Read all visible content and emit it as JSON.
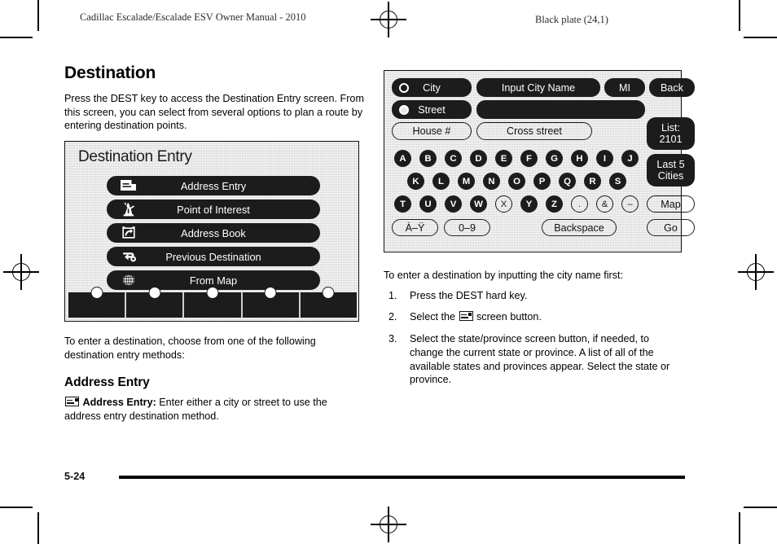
{
  "header": {
    "left_running_head": "Cadillac Escalade/Escalade ESV Owner Manual - 2010",
    "right_running_head": "Black plate (24,1)"
  },
  "footer": {
    "page_number": "5-24"
  },
  "left_column": {
    "heading": "Destination",
    "intro": "Press the DEST key to access the Destination Entry screen. From this screen, you can select from several options to plan a route by entering destination points.",
    "after_figure": "To enter a destination, choose from one of the following destination entry methods:",
    "subheading": "Address Entry",
    "address_entry_bold": "Address Entry:",
    "address_entry_text": " Enter either a city or street to use the address entry destination method."
  },
  "figure_destination_entry": {
    "title": "Destination Entry",
    "menu_items": [
      {
        "label": "Address Entry",
        "icon": "address-card-icon"
      },
      {
        "label": "Point of Interest",
        "icon": "statue-of-liberty-icon"
      },
      {
        "label": "Address Book",
        "icon": "open-book-icon"
      },
      {
        "label": "Previous Destination",
        "icon": "return-arrow-icon"
      },
      {
        "label": "From Map",
        "icon": "globe-icon"
      }
    ],
    "bottom_soft_keys": [
      "",
      "",
      "",
      "",
      ""
    ]
  },
  "figure_city_input": {
    "city_label": "City",
    "city_field_value": "Input City Name",
    "state_button": "MI",
    "back_button": "Back",
    "street_label": "Street",
    "street_field_value": "",
    "house_number_button": "House #",
    "cross_street_button": "Cross street",
    "list_button_line1": "List:",
    "list_button_line2": "2101",
    "last5_line1": "Last 5",
    "last5_line2": "Cities",
    "keyboard_row1": [
      "A",
      "B",
      "C",
      "D",
      "E",
      "F",
      "G",
      "H",
      "I",
      "J"
    ],
    "keyboard_row2": [
      "K",
      "L",
      "M",
      "N",
      "O",
      "P",
      "Q",
      "R",
      "S"
    ],
    "keyboard_row3": [
      "T",
      "U",
      "V",
      "W",
      "X",
      "Y",
      "Z"
    ],
    "symbol_keys": [
      ".",
      "&",
      "–"
    ],
    "disabled_letter": "X",
    "accent_button": "À–Ÿ",
    "numeric_button": "0–9",
    "backspace_button": "Backspace",
    "map_button": "Map",
    "go_button": "Go"
  },
  "right_column": {
    "intro": "To enter a destination by inputting the city name first:",
    "steps": [
      {
        "num": "1.",
        "text_before": "Press the DEST hard key.",
        "icon": "",
        "text_after": ""
      },
      {
        "num": "2.",
        "text_before": "Select the ",
        "icon": "address-card-icon",
        "text_after": " screen button."
      },
      {
        "num": "3.",
        "text_before": "Select the state/province screen button, if needed, to change the current state or province. A list of all of the available states and provinces appear. Select the state or province.",
        "icon": "",
        "text_after": ""
      }
    ]
  },
  "colors": {
    "ink": "#000000",
    "screen_bg": "#cfcfcf",
    "button_fill": "#1c1c1c"
  }
}
